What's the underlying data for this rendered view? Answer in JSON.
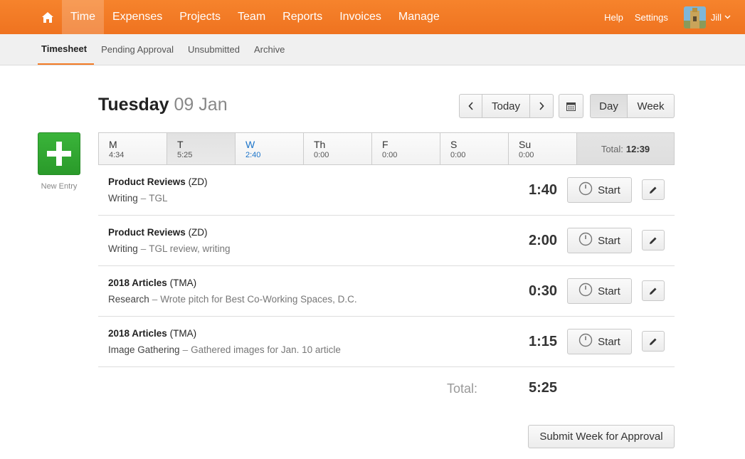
{
  "nav": {
    "items": [
      {
        "label": "Time",
        "active": true
      },
      {
        "label": "Expenses"
      },
      {
        "label": "Projects"
      },
      {
        "label": "Team"
      },
      {
        "label": "Reports"
      },
      {
        "label": "Invoices"
      },
      {
        "label": "Manage"
      }
    ],
    "help": "Help",
    "settings": "Settings",
    "user": "Jill"
  },
  "subnav": {
    "items": [
      {
        "label": "Timesheet",
        "active": true
      },
      {
        "label": "Pending Approval"
      },
      {
        "label": "Unsubmitted"
      },
      {
        "label": "Archive"
      }
    ]
  },
  "new_entry": {
    "label": "New Entry"
  },
  "header": {
    "day_name": "Tuesday",
    "date": "09 Jan",
    "today_label": "Today",
    "view_day": "Day",
    "view_week": "Week"
  },
  "week": {
    "days": [
      {
        "label": "M",
        "hours": "4:34"
      },
      {
        "label": "T",
        "hours": "5:25",
        "selected": true
      },
      {
        "label": "W",
        "hours": "2:40",
        "today": true
      },
      {
        "label": "Th",
        "hours": "0:00"
      },
      {
        "label": "F",
        "hours": "0:00"
      },
      {
        "label": "S",
        "hours": "0:00"
      },
      {
        "label": "Su",
        "hours": "0:00"
      }
    ],
    "total_label": "Total:",
    "total_value": "12:39"
  },
  "entries": [
    {
      "project": "Product Reviews",
      "client": "(ZD)",
      "task": "Writing",
      "note": "TGL",
      "duration": "1:40"
    },
    {
      "project": "Product Reviews",
      "client": "(ZD)",
      "task": "Writing",
      "note": "TGL review, writing",
      "duration": "2:00"
    },
    {
      "project": "2018 Articles",
      "client": "(TMA)",
      "task": "Research",
      "note": "Wrote pitch for Best Co-Working Spaces, D.C.",
      "duration": "0:30"
    },
    {
      "project": "2018 Articles",
      "client": "(TMA)",
      "task": "Image Gathering",
      "note": "Gathered images for Jan. 10 article",
      "duration": "1:15"
    }
  ],
  "start_label": "Start",
  "entry_separator": "–",
  "total": {
    "label": "Total:",
    "value": "5:25"
  },
  "submit_label": "Submit Week for Approval",
  "colors": {
    "brand": "#f37b25",
    "new_entry": "#2fa52f",
    "today": "#1a73c9"
  }
}
